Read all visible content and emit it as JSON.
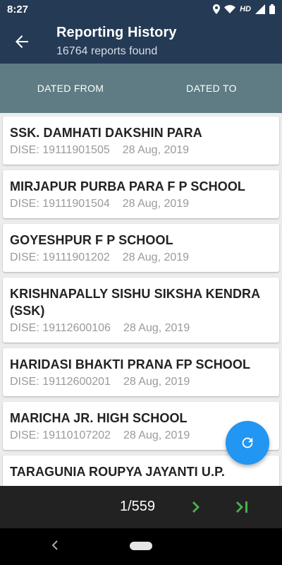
{
  "status_bar": {
    "time": "8:27",
    "network": "HD"
  },
  "header": {
    "title": "Reporting History",
    "subtitle": "16764 reports found"
  },
  "filters": {
    "dated_from": "DATED FROM",
    "dated_to": "DATED TO"
  },
  "reports": [
    {
      "name": "SSK. DAMHATI DAKSHIN PARA",
      "dise": "DISE: 19111901505",
      "date": "28 Aug, 2019"
    },
    {
      "name": "MIRJAPUR PURBA PARA F P SCHOOL",
      "dise": "DISE: 19111901504",
      "date": "28 Aug, 2019"
    },
    {
      "name": "GOYESHPUR F P SCHOOL",
      "dise": "DISE: 19111901202",
      "date": "28 Aug, 2019"
    },
    {
      "name": "KRISHNAPALLY SISHU SIKSHA KENDRA (SSK)",
      "dise": "DISE: 19112600106",
      "date": "28 Aug, 2019"
    },
    {
      "name": "HARIDASI BHAKTI PRANA FP SCHOOL",
      "dise": "DISE: 19112600201",
      "date": "28 Aug, 2019"
    },
    {
      "name": "MARICHA JR. HIGH SCHOOL",
      "dise": "DISE: 19110107202",
      "date": "28 Aug, 2019"
    },
    {
      "name": "TARAGUNIA ROUPYA JAYANTI U.P.",
      "dise": "",
      "date": ""
    }
  ],
  "pagination": {
    "indicator": "1/559"
  },
  "icons": {
    "back": "arrow-left-icon",
    "refresh": "refresh-icon",
    "next": "chevron-right-icon",
    "last": "last-page-icon"
  },
  "colors": {
    "app_bar": "#243a55",
    "filter_bar": "#5f7b84",
    "fab": "#2196f3",
    "pager_accent": "#4caf50"
  }
}
